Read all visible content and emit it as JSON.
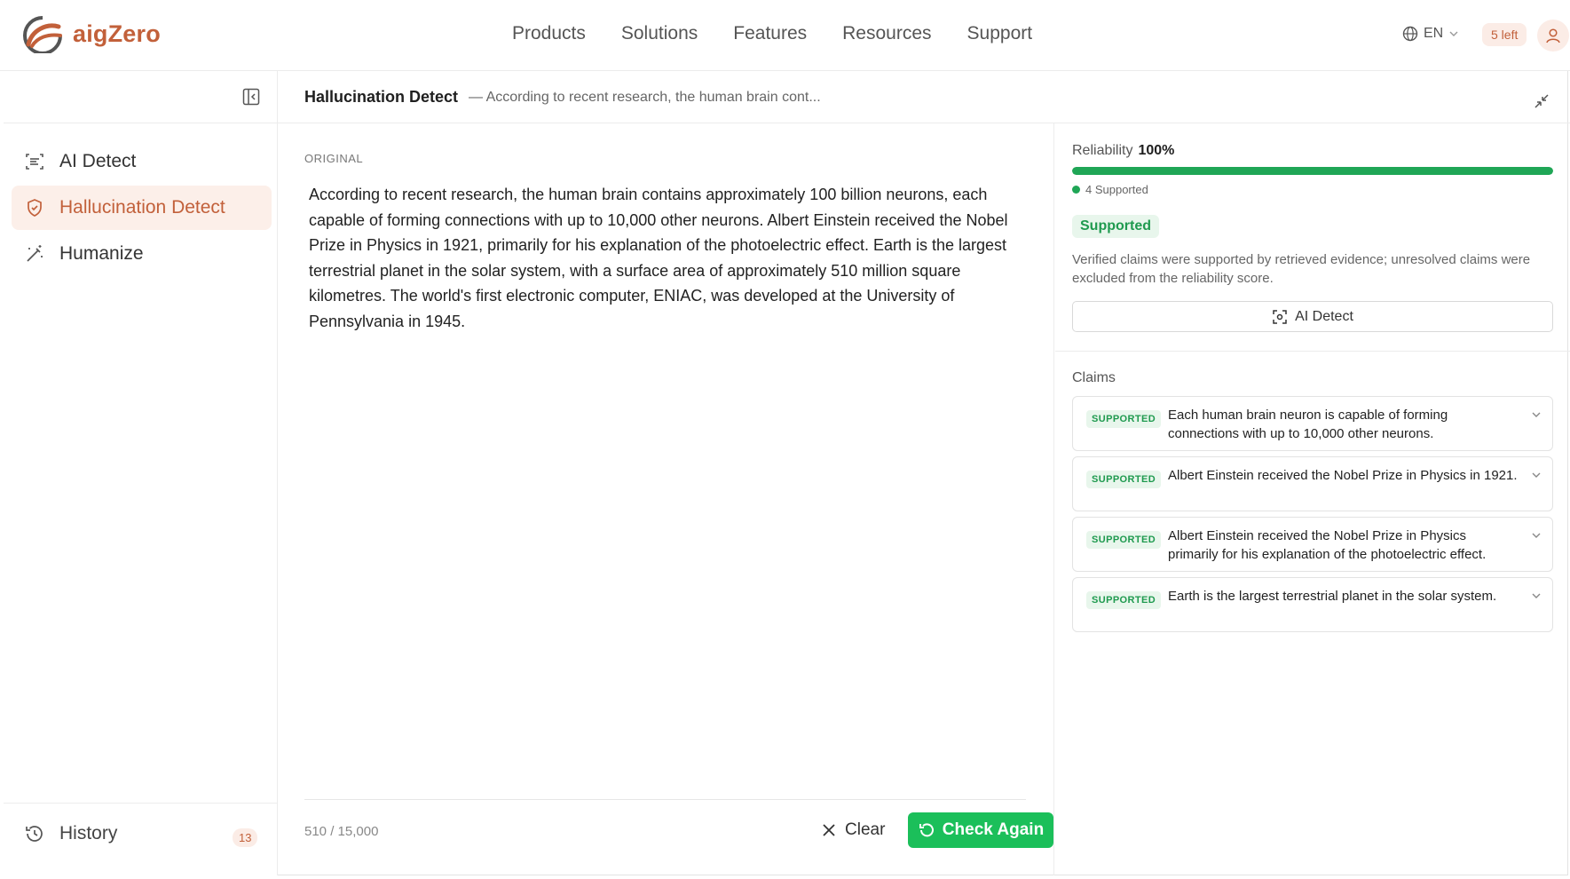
{
  "brand": {
    "name": "aigZero",
    "accent": "#c2603a",
    "success": "#1fa656"
  },
  "nav": {
    "menu": [
      "Products",
      "Solutions",
      "Features",
      "Resources",
      "Support"
    ],
    "language": "EN",
    "credits": "5 left"
  },
  "sidebar": {
    "items": [
      {
        "label": "AI Detect",
        "icon": "scan-text-icon",
        "active": false
      },
      {
        "label": "Hallucination Detect",
        "icon": "shield-check-icon",
        "active": true
      },
      {
        "label": "Humanize",
        "icon": "magic-wand-icon",
        "active": false
      }
    ],
    "history": {
      "label": "History",
      "count": "13"
    }
  },
  "header": {
    "title": "Hallucination Detect",
    "subtitle": "— According to recent research, the human brain cont..."
  },
  "main": {
    "section_label": "ORIGINAL",
    "text": "According to recent research, the human brain contains approximately 100 billion neurons, each capable of forming connections with up to 10,000 other neurons. Albert Einstein received the Nobel Prize in Physics in 1921, primarily for his explanation of the photoelectric effect. Earth is the largest terrestrial planet in the solar system, with a surface area of approximately 510 million square kilometres. The world's first electronic computer, ENIAC, was developed at the University of Pennsylvania in 1945.",
    "char_count": "510 / 15,000",
    "clear_label": "Clear",
    "check_label": "Check Again"
  },
  "results": {
    "reliability_label": "Reliability",
    "reliability_value": "100%",
    "reliability_fraction": 1.0,
    "legend": "4 Supported",
    "status": "Supported",
    "description": "Verified claims were supported by retrieved evidence; unresolved claims were excluded from the reliability score.",
    "ai_detect_label": "AI Detect",
    "claims_label": "Claims",
    "claims": [
      {
        "badge": "SUPPORTED",
        "text": "Each human brain neuron is capable of forming connections with up to 10,000 other neurons."
      },
      {
        "badge": "SUPPORTED",
        "text": "Albert Einstein received the Nobel Prize in Physics in 1921."
      },
      {
        "badge": "SUPPORTED",
        "text": "Albert Einstein received the Nobel Prize in Physics primarily for his explanation of the photoelectric effect."
      },
      {
        "badge": "SUPPORTED",
        "text": "Earth is the largest terrestrial planet in the solar system."
      }
    ]
  }
}
